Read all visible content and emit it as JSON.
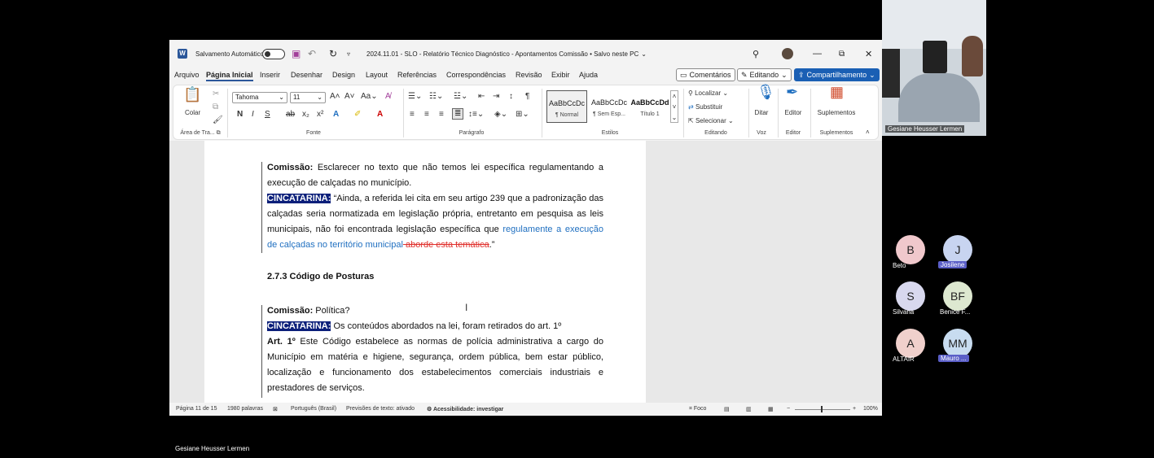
{
  "titlebar": {
    "autosave_label": "Salvamento Automático",
    "doc_title": "2024.11.01 - SLO - Relatório Técnico Diagnóstico - Apontamentos Comissão • Salvo neste PC",
    "chevron": "⌄"
  },
  "menu": {
    "items": [
      "Arquivo",
      "Página Inicial",
      "Inserir",
      "Desenhar",
      "Design",
      "Layout",
      "Referências",
      "Correspondências",
      "Revisão",
      "Exibir",
      "Ajuda"
    ],
    "comments": "Comentários",
    "editing": "Editando",
    "share": "Compartilhamento"
  },
  "ribbon": {
    "paste": "Colar",
    "clipboard_group": "Área de Tra...",
    "font_name": "Tahoma",
    "font_size": "11",
    "font_group": "Fonte",
    "paragraph_group": "Parágrafo",
    "styles": [
      {
        "preview": "AaBbCcDc",
        "name": "¶ Normal"
      },
      {
        "preview": "AaBbCcDc",
        "name": "¶ Sem Esp..."
      },
      {
        "preview": "AaBbCcDd",
        "name": "Título 1"
      }
    ],
    "styles_group": "Estilos",
    "find": "Localizar",
    "replace": "Substituir",
    "select": "Selecionar",
    "editing_group": "Editando",
    "dictate": "Ditar",
    "voice_group": "Voz",
    "editor": "Editor",
    "editor_group": "Editor",
    "addins": "Suplementos",
    "addins_group": "Suplementos"
  },
  "document": {
    "p1_label": "Comissão:",
    "p1_text": " Esclarecer no texto que não temos lei específica regulamentando a execução de calçadas no município.",
    "p2_label": "CINCATARINA:",
    "p2_text": " “Ainda, a referida lei cita em seu artigo 239 que a padronização das calçadas seria normatizada em legislação própria, entretanto em pesquisa as leis municipais, não foi encontrada legislação específica que ",
    "p2_inserted": "regulamente a execução de calçadas no território municipal",
    "p2_deleted": " aborde esta temática",
    "p2_end": ".”",
    "heading": "2.7.3 Código de Posturas",
    "p3_label": "Comissão:",
    "p3_text": " Política?",
    "p4_label": "CINCATARINA:",
    "p4_text": " Os conteúdos abordados na lei, foram retirados do art. 1º",
    "p5_label": "Art. 1º",
    "p5_text": " Este Código estabelece as normas de polícia administrativa a cargo do Município em matéria e higiene, segurança, ordem pública, bem estar público, localização e funcionamento dos estabelecimentos comerciais industriais e prestadores de serviços."
  },
  "status": {
    "page": "Página 11 de 15",
    "words": "1980 palavras",
    "language": "Português (Brasil)",
    "predictions": "Previsões de texto: ativado",
    "accessibility": "Acessibilidade: investigar",
    "focus": "Foco",
    "zoom": "100%"
  },
  "video": {
    "name": "Gesiane Heusser Lermen"
  },
  "participants": [
    {
      "initials": "B",
      "name": "Beto",
      "color": "#f0c8cc"
    },
    {
      "initials": "J",
      "name": "Josilene",
      "color": "#c8d4f0"
    },
    {
      "initials": "S",
      "name": "Silvana",
      "color": "#d8d8ee"
    },
    {
      "initials": "BF",
      "name": "Benice F...",
      "color": "#dde8d0"
    },
    {
      "initials": "A",
      "name": "ALTAIR",
      "color": "#f0d0cc"
    },
    {
      "initials": "MM",
      "name": "Mauro ...",
      "color": "#c8dcf0"
    }
  ],
  "footer": {
    "presenter": "Gesiane Heusser Lermen"
  }
}
